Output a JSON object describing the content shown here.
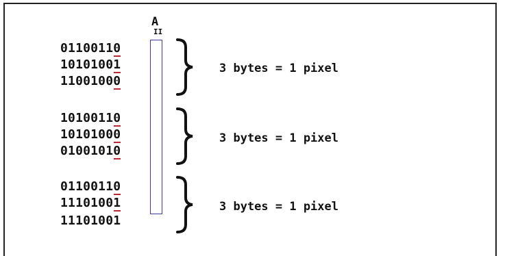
{
  "diagram": {
    "column_label": "A",
    "column_marker": "II",
    "groups": [
      {
        "bytes": [
          {
            "prefix": "0110011",
            "lsb": "0",
            "marked": true
          },
          {
            "prefix": "1010100",
            "lsb": "1",
            "marked": true
          },
          {
            "prefix": "1100100",
            "lsb": "0",
            "marked": true
          }
        ],
        "caption": "3 bytes = 1 pixel"
      },
      {
        "bytes": [
          {
            "prefix": "1010011",
            "lsb": "0",
            "marked": true
          },
          {
            "prefix": "1010100",
            "lsb": "0",
            "marked": true
          },
          {
            "prefix": "0100101",
            "lsb": "0",
            "marked": true
          }
        ],
        "caption": "3 bytes = 1 pixel"
      },
      {
        "bytes": [
          {
            "prefix": "0110011",
            "lsb": "0",
            "marked": true
          },
          {
            "prefix": "1110100",
            "lsb": "1",
            "marked": true
          },
          {
            "prefix": "1110100",
            "lsb": "1",
            "marked": false
          }
        ],
        "caption": "3 bytes = 1 pixel"
      }
    ]
  }
}
